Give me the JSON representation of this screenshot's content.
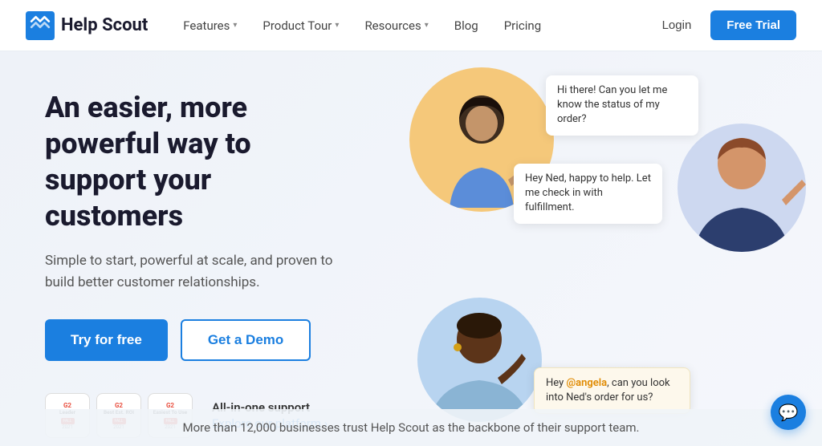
{
  "nav": {
    "logo_text": "Help Scout",
    "links": [
      {
        "label": "Features",
        "has_dropdown": true
      },
      {
        "label": "Product Tour",
        "has_dropdown": true
      },
      {
        "label": "Resources",
        "has_dropdown": true
      },
      {
        "label": "Blog",
        "has_dropdown": false
      },
      {
        "label": "Pricing",
        "has_dropdown": false
      }
    ],
    "login_label": "Login",
    "free_trial_label": "Free Trial"
  },
  "hero": {
    "title": "An easier, more powerful way to support your customers",
    "subtitle": "Simple to start, powerful at scale, and proven to build better customer relationships.",
    "try_button": "Try for free",
    "demo_button": "Get a Demo",
    "platform_label": "All-in-one support",
    "platform_link": "Explore our platform ›",
    "badges": [
      {
        "g2": "G2",
        "title": "Leader",
        "strip": "FALL",
        "year": "2021"
      },
      {
        "g2": "G2",
        "title": "Best Est. ROI",
        "strip": "FALL",
        "year": "2021"
      },
      {
        "g2": "G2",
        "title": "Easiest To Use",
        "strip": "FALL Mid-Market",
        "year": "2021"
      }
    ]
  },
  "chat_bubbles": [
    {
      "text": "Hi there! Can you let me know the status of my order?"
    },
    {
      "text": "Hey Ned, happy to help. Let me check in with fulfillment."
    },
    {
      "mention": "@angela",
      "text": ", can you look into Ned's order for us?",
      "prefix": "Hey "
    }
  ],
  "bottom": {
    "text": "More than 12,000 businesses trust Help Scout as the backbone of their support team."
  },
  "chat_button_icon": "💬"
}
